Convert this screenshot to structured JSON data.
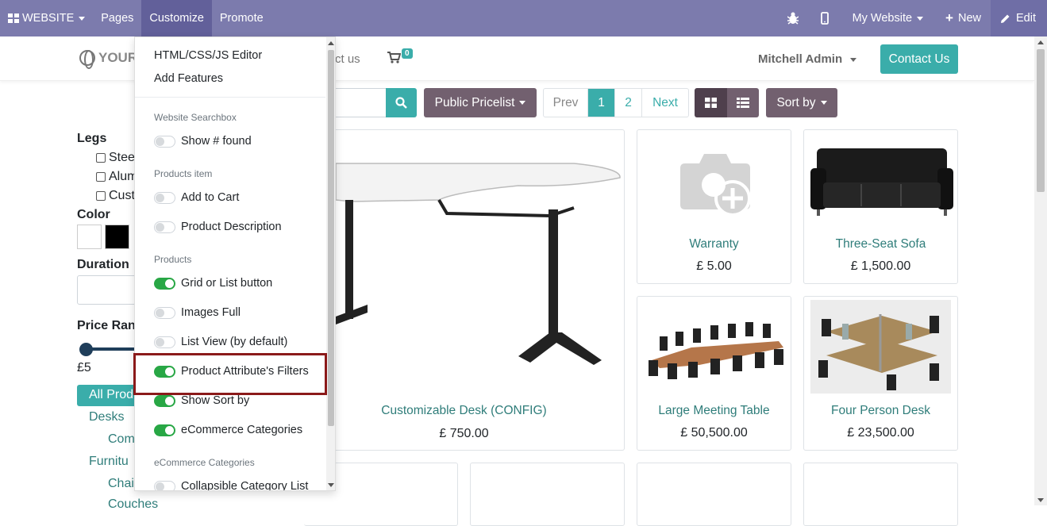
{
  "topbar": {
    "website_label": "WEBSITE",
    "pages_label": "Pages",
    "customize_label": "Customize",
    "promote_label": "Promote",
    "my_website_label": "My Website",
    "new_label": "New",
    "edit_label": "Edit"
  },
  "header": {
    "logo_text": "YOUR",
    "nav_partial": "ct us",
    "cart_count": "0",
    "user_name": "Mitchell Admin",
    "contact_button": "Contact Us"
  },
  "toolbar": {
    "pricelist_label": "Public Pricelist",
    "pager": {
      "prev": "Prev",
      "page1": "1",
      "page2": "2",
      "next": "Next"
    },
    "sort_label": "Sort by"
  },
  "sidebar": {
    "legs_heading": "Legs",
    "legs_options": [
      "Stee",
      "Alum",
      "Cust"
    ],
    "color_heading": "Color",
    "colors": [
      "#ffffff",
      "#000000"
    ],
    "duration_heading": "Duration",
    "price_heading": "Price Rang",
    "price_min": "£5",
    "all_products": "All Prod",
    "categories": [
      "Desks",
      "Com",
      "Furnitu",
      "Chai",
      "Couches"
    ]
  },
  "products": [
    {
      "name": "Customizable Desk (CONFIG)",
      "price": "£ 750.00"
    },
    {
      "name": "Warranty",
      "price": "£ 5.00"
    },
    {
      "name": "Three-Seat Sofa",
      "price": "£ 1,500.00"
    },
    {
      "name": "Large Meeting Table",
      "price": "£ 50,500.00"
    },
    {
      "name": "Four Person Desk",
      "price": "£ 23,500.00"
    }
  ],
  "customize_menu": {
    "html_editor": "HTML/CSS/JS Editor",
    "add_features": "Add Features",
    "sections": [
      {
        "heading": "Website Searchbox",
        "options": [
          {
            "label": "Show # found",
            "enabled": false
          }
        ]
      },
      {
        "heading": "Products item",
        "options": [
          {
            "label": "Add to Cart",
            "enabled": false
          },
          {
            "label": "Product Description",
            "enabled": false
          }
        ]
      },
      {
        "heading": "Products",
        "options": [
          {
            "label": "Grid or List button",
            "enabled": true
          },
          {
            "label": "Images Full",
            "enabled": false
          },
          {
            "label": "List View (by default)",
            "enabled": false
          },
          {
            "label": "Product Attribute's Filters",
            "enabled": true
          },
          {
            "label": "Show Sort by",
            "enabled": true
          },
          {
            "label": "eCommerce Categories",
            "enabled": true
          }
        ]
      },
      {
        "heading": "eCommerce Categories",
        "options": [
          {
            "label": "Collapsible Category List",
            "enabled": false
          }
        ]
      }
    ]
  },
  "colors": {
    "topbar": "#7c7bad",
    "topbar_active": "#62609a",
    "primary": "#3aadaa",
    "secondary": "#72606f",
    "toggle_on": "#28a745",
    "highlight": "#8b1a1a"
  }
}
